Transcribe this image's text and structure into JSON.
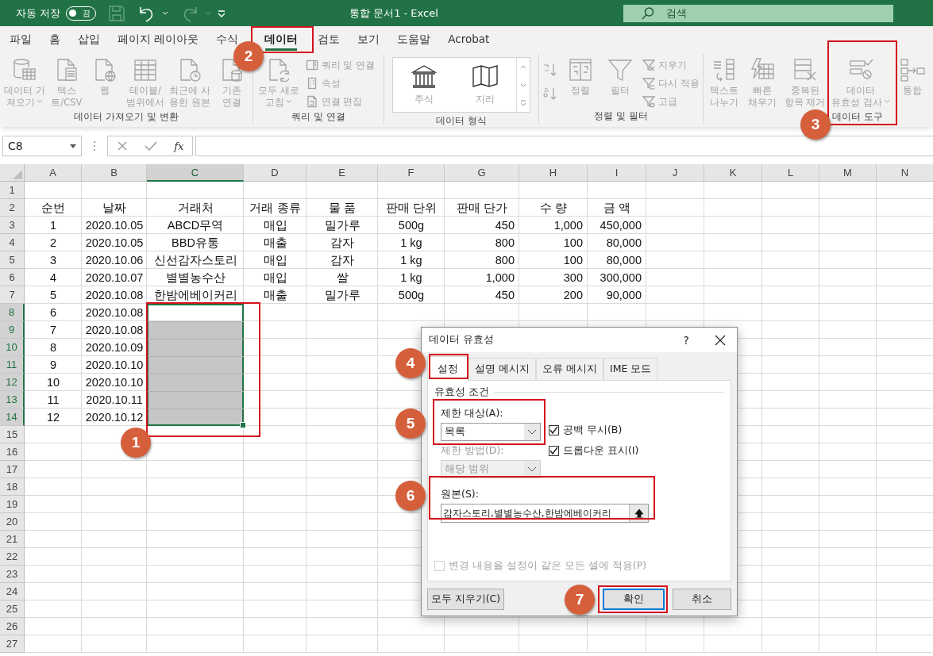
{
  "title_bar": {
    "autosave_label": "자동 저장",
    "autosave_state": "끔",
    "autosave_on": false,
    "title": "통합 문서1  -  Excel",
    "search_placeholder": "검색"
  },
  "tabs": [
    {
      "label": "파일",
      "selected": false
    },
    {
      "label": "홈",
      "selected": false
    },
    {
      "label": "삽입",
      "selected": false
    },
    {
      "label": "페이지 레이아웃",
      "selected": false
    },
    {
      "label": "수식",
      "selected": false
    },
    {
      "label": "데이터",
      "selected": true
    },
    {
      "label": "검토",
      "selected": false
    },
    {
      "label": "보기",
      "selected": false
    },
    {
      "label": "도움말",
      "selected": false
    },
    {
      "label": "Acrobat",
      "selected": false
    }
  ],
  "ribbon": {
    "disabled": true,
    "groups": [
      {
        "label": "데이터 가져오기 및 변환",
        "items": [
          {
            "kind": "large",
            "lines": [
              "데이터 가",
              "져오기"
            ],
            "dropdown": true
          },
          {
            "kind": "large",
            "lines": [
              "텍스",
              "트/CSV"
            ]
          },
          {
            "kind": "large",
            "lines": [
              "웹"
            ]
          },
          {
            "kind": "large",
            "lines": [
              "테이블/",
              "범위에서"
            ]
          },
          {
            "kind": "large",
            "lines": [
              "최근에 사",
              "용한 원본"
            ]
          },
          {
            "kind": "large",
            "lines": [
              "기존",
              "연결"
            ]
          }
        ]
      },
      {
        "label": "쿼리 및 연결",
        "items": [
          {
            "kind": "large",
            "lines": [
              "모두 새로",
              "고침"
            ],
            "dropdown": true
          },
          {
            "kind": "small",
            "label": "쿼리 및 연결"
          },
          {
            "kind": "small",
            "label": "속성"
          },
          {
            "kind": "small",
            "label": "연결 편집"
          }
        ]
      },
      {
        "label": "데이터 형식",
        "items": [
          {
            "kind": "gallery",
            "options": [
              "주식",
              "지리"
            ]
          }
        ]
      },
      {
        "label": "정렬 및 필터",
        "items": [
          {
            "kind": "sort_pair"
          },
          {
            "kind": "large",
            "lines": [
              "정렬"
            ]
          },
          {
            "kind": "large",
            "lines": [
              "필터"
            ]
          },
          {
            "kind": "small",
            "label": "지우기"
          },
          {
            "kind": "small",
            "label": "다시 적용"
          },
          {
            "kind": "small",
            "label": "고급"
          }
        ]
      },
      {
        "label": "데이터 도구",
        "items": [
          {
            "kind": "large",
            "lines": [
              "텍스트",
              "나누기"
            ]
          },
          {
            "kind": "large",
            "lines": [
              "빠른",
              "채우기"
            ]
          },
          {
            "kind": "large",
            "lines": [
              "중복된",
              "항목 제거"
            ]
          },
          {
            "kind": "large",
            "lines": [
              "데이터",
              "유효성 검사"
            ],
            "dropdown": true
          },
          {
            "kind": "large",
            "lines": [
              "통합"
            ]
          }
        ]
      }
    ]
  },
  "formula_bar": {
    "name_box": "C8",
    "function_button": "fx"
  },
  "sheet": {
    "columns": [
      {
        "label": "A",
        "selected": false
      },
      {
        "label": "B",
        "selected": false
      },
      {
        "label": "C",
        "selected": true
      },
      {
        "label": "D",
        "selected": false
      },
      {
        "label": "E",
        "selected": false
      },
      {
        "label": "F",
        "selected": false
      },
      {
        "label": "G",
        "selected": false
      },
      {
        "label": "H",
        "selected": false
      },
      {
        "label": "I",
        "selected": false
      },
      {
        "label": "J",
        "selected": false
      },
      {
        "label": "K",
        "selected": false
      },
      {
        "label": "L",
        "selected": false
      },
      {
        "label": "M",
        "selected": false
      },
      {
        "label": "N",
        "selected": false
      }
    ],
    "rows": [
      {
        "label": "1",
        "selected": false
      },
      {
        "label": "2",
        "selected": false,
        "cells": [
          "순번",
          "날짜",
          "거래처",
          "거래 종류",
          "물 품",
          "판매 단위",
          "판매 단가",
          "수 량",
          "금 액"
        ]
      },
      {
        "label": "3",
        "selected": false,
        "cells": [
          "1",
          "2020.10.05",
          "ABCD무역",
          "매입",
          "밀가루",
          "500g",
          "450",
          "1,000",
          "450,000"
        ]
      },
      {
        "label": "4",
        "selected": false,
        "cells": [
          "2",
          "2020.10.05",
          "BBD유통",
          "매출",
          "감자",
          "1 kg",
          "800",
          "100",
          "80,000"
        ]
      },
      {
        "label": "5",
        "selected": false,
        "cells": [
          "3",
          "2020.10.06",
          "신선감자스토리",
          "매입",
          "감자",
          "1 kg",
          "800",
          "100",
          "80,000"
        ]
      },
      {
        "label": "6",
        "selected": false,
        "cells": [
          "4",
          "2020.10.07",
          "별별농수산",
          "매입",
          "쌀",
          "1 kg",
          "1,000",
          "300",
          "300,000"
        ]
      },
      {
        "label": "7",
        "selected": false,
        "cells": [
          "5",
          "2020.10.08",
          "한밤에베이커리",
          "매출",
          "밀가루",
          "500g",
          "450",
          "200",
          "90,000"
        ]
      },
      {
        "label": "8",
        "selected": true,
        "cells": [
          "6",
          "2020.10.08"
        ]
      },
      {
        "label": "9",
        "selected": true,
        "cells": [
          "7",
          "2020.10.08"
        ]
      },
      {
        "label": "10",
        "selected": true,
        "cells": [
          "8",
          "2020.10.09"
        ]
      },
      {
        "label": "11",
        "selected": true,
        "cells": [
          "9",
          "2020.10.10"
        ]
      },
      {
        "label": "12",
        "selected": true,
        "cells": [
          "10",
          "2020.10.10"
        ]
      },
      {
        "label": "13",
        "selected": true,
        "cells": [
          "11",
          "2020.10.11"
        ]
      },
      {
        "label": "14",
        "selected": true,
        "cells": [
          "12",
          "2020.10.12"
        ]
      },
      {
        "label": "15",
        "selected": false
      },
      {
        "label": "16",
        "selected": false
      },
      {
        "label": "17",
        "selected": false
      },
      {
        "label": "18",
        "selected": false
      },
      {
        "label": "19",
        "selected": false
      },
      {
        "label": "20",
        "selected": false
      },
      {
        "label": "21",
        "selected": false
      },
      {
        "label": "22",
        "selected": false
      },
      {
        "label": "23",
        "selected": false
      },
      {
        "label": "24",
        "selected": false
      },
      {
        "label": "25",
        "selected": false
      },
      {
        "label": "26",
        "selected": false
      },
      {
        "label": "27",
        "selected": false
      }
    ]
  },
  "dialog": {
    "title": "데이터 유효성",
    "help": "?",
    "tabs": [
      {
        "label": "설정",
        "selected": true
      },
      {
        "label": "설명 메시지",
        "selected": false
      },
      {
        "label": "오류 메시지",
        "selected": false
      },
      {
        "label": "IME 모드",
        "selected": false
      }
    ],
    "section": "유효성 조건",
    "allow": {
      "label": "제한 대상(A):",
      "value": "목록"
    },
    "checkboxes": [
      {
        "label": "공백 무시(B)",
        "checked": true
      },
      {
        "label": "드롭다운 표시(I)",
        "checked": true
      }
    ],
    "data": {
      "label": "제한 방법(D):",
      "value": "해당 범위",
      "disabled": true
    },
    "source": {
      "label": "원본(S):",
      "value": "감자스토리,별별농수산,한밤에베이커리"
    },
    "apply_all": {
      "label": "변경 내용을 설정이 같은 모든 셀에 적용(P)",
      "checked": false,
      "disabled": true
    },
    "buttons": [
      {
        "label": "모두 지우기(C)",
        "default": false
      },
      {
        "label": "확인",
        "default": true
      },
      {
        "label": "취소",
        "default": false
      }
    ]
  },
  "annotations": [
    {
      "number": "1"
    },
    {
      "number": "2"
    },
    {
      "number": "3"
    },
    {
      "number": "4"
    },
    {
      "number": "5"
    },
    {
      "number": "6"
    },
    {
      "number": "7"
    }
  ]
}
